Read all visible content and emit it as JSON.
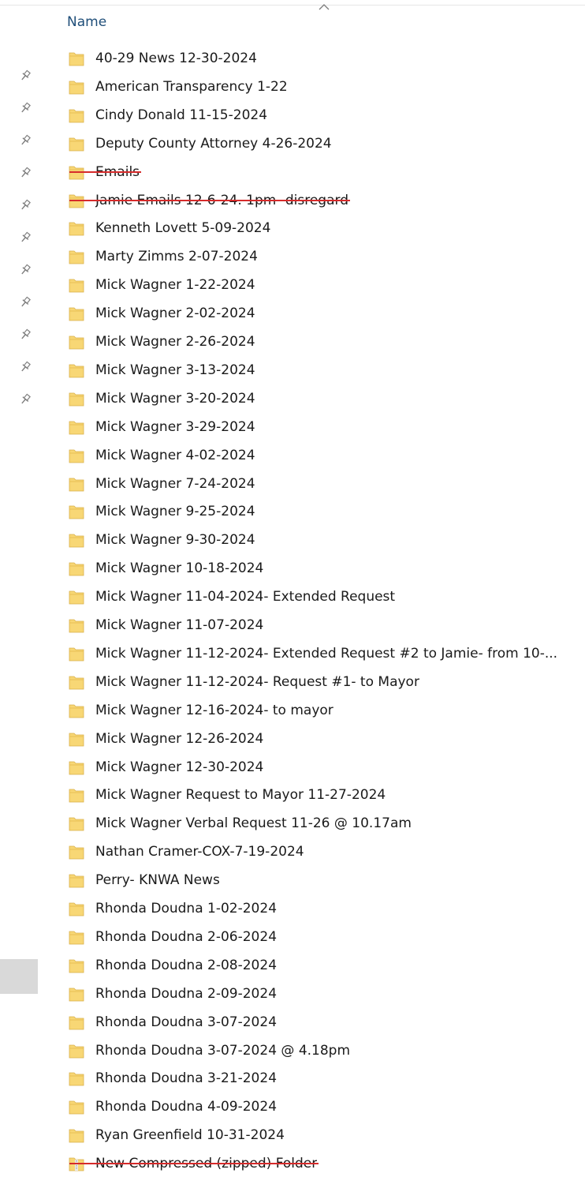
{
  "window": {
    "column_header": "Name",
    "sort_indicator_icon": "chevron-up-icon",
    "pin_icon": "pin-icon",
    "folder_icon": "folder-icon",
    "zip_icon": "zip-folder-icon",
    "strike_color": "#d62b2b",
    "folder_color": "#f8d775",
    "header_color": "#1f4e79"
  },
  "files": [
    {
      "name": "40-29 News 12-30-2024",
      "type": "folder",
      "struck": false
    },
    {
      "name": "American Transparency 1-22",
      "type": "folder",
      "struck": false
    },
    {
      "name": "Cindy Donald 11-15-2024",
      "type": "folder",
      "struck": false
    },
    {
      "name": "Deputy County Attorney 4-26-2024",
      "type": "folder",
      "struck": false
    },
    {
      "name": "Emails",
      "type": "folder",
      "struck": true
    },
    {
      "name": "Jamie Emails 12-6-24. 1pm- disregard",
      "type": "folder",
      "struck": true
    },
    {
      "name": "Kenneth Lovett 5-09-2024",
      "type": "folder",
      "struck": false
    },
    {
      "name": "Marty Zimms 2-07-2024",
      "type": "folder",
      "struck": false
    },
    {
      "name": "Mick Wagner 1-22-2024",
      "type": "folder",
      "struck": false
    },
    {
      "name": "Mick Wagner 2-02-2024",
      "type": "folder",
      "struck": false
    },
    {
      "name": "Mick Wagner 2-26-2024",
      "type": "folder",
      "struck": false
    },
    {
      "name": "Mick Wagner 3-13-2024",
      "type": "folder",
      "struck": false
    },
    {
      "name": "Mick Wagner 3-20-2024",
      "type": "folder",
      "struck": false
    },
    {
      "name": "Mick Wagner 3-29-2024",
      "type": "folder",
      "struck": false
    },
    {
      "name": "Mick Wagner 4-02-2024",
      "type": "folder",
      "struck": false
    },
    {
      "name": "Mick Wagner 7-24-2024",
      "type": "folder",
      "struck": false
    },
    {
      "name": "Mick Wagner 9-25-2024",
      "type": "folder",
      "struck": false
    },
    {
      "name": "Mick Wagner 9-30-2024",
      "type": "folder",
      "struck": false
    },
    {
      "name": "Mick Wagner 10-18-2024",
      "type": "folder",
      "struck": false
    },
    {
      "name": "Mick Wagner 11-04-2024- Extended Request",
      "type": "folder",
      "struck": false
    },
    {
      "name": "Mick Wagner 11-07-2024",
      "type": "folder",
      "struck": false
    },
    {
      "name": "Mick Wagner 11-12-2024- Extended Request #2 to Jamie- from 10-...",
      "type": "folder",
      "struck": false
    },
    {
      "name": "Mick Wagner 11-12-2024- Request #1- to Mayor",
      "type": "folder",
      "struck": false
    },
    {
      "name": "Mick Wagner 12-16-2024- to mayor",
      "type": "folder",
      "struck": false
    },
    {
      "name": "Mick Wagner 12-26-2024",
      "type": "folder",
      "struck": false
    },
    {
      "name": "Mick Wagner 12-30-2024",
      "type": "folder",
      "struck": false
    },
    {
      "name": "Mick Wagner Request to Mayor 11-27-2024",
      "type": "folder",
      "struck": false
    },
    {
      "name": "Mick Wagner Verbal Request 11-26 @ 10.17am",
      "type": "folder",
      "struck": false
    },
    {
      "name": "Nathan Cramer-COX-7-19-2024",
      "type": "folder",
      "struck": false
    },
    {
      "name": "Perry- KNWA News",
      "type": "folder",
      "struck": false
    },
    {
      "name": "Rhonda Doudna 1-02-2024",
      "type": "folder",
      "struck": false
    },
    {
      "name": "Rhonda Doudna 2-06-2024",
      "type": "folder",
      "struck": false
    },
    {
      "name": "Rhonda Doudna 2-08-2024",
      "type": "folder",
      "struck": false
    },
    {
      "name": "Rhonda Doudna 2-09-2024",
      "type": "folder",
      "struck": false
    },
    {
      "name": "Rhonda Doudna 3-07-2024",
      "type": "folder",
      "struck": false
    },
    {
      "name": "Rhonda Doudna 3-07-2024 @ 4.18pm",
      "type": "folder",
      "struck": false
    },
    {
      "name": "Rhonda Doudna 3-21-2024",
      "type": "folder",
      "struck": false
    },
    {
      "name": "Rhonda Doudna 4-09-2024",
      "type": "folder",
      "struck": false
    },
    {
      "name": "Ryan Greenfield 10-31-2024",
      "type": "folder",
      "struck": false
    },
    {
      "name": "New Compressed (zipped) Folder",
      "type": "zip",
      "struck": true
    }
  ],
  "pinned_count": 11
}
